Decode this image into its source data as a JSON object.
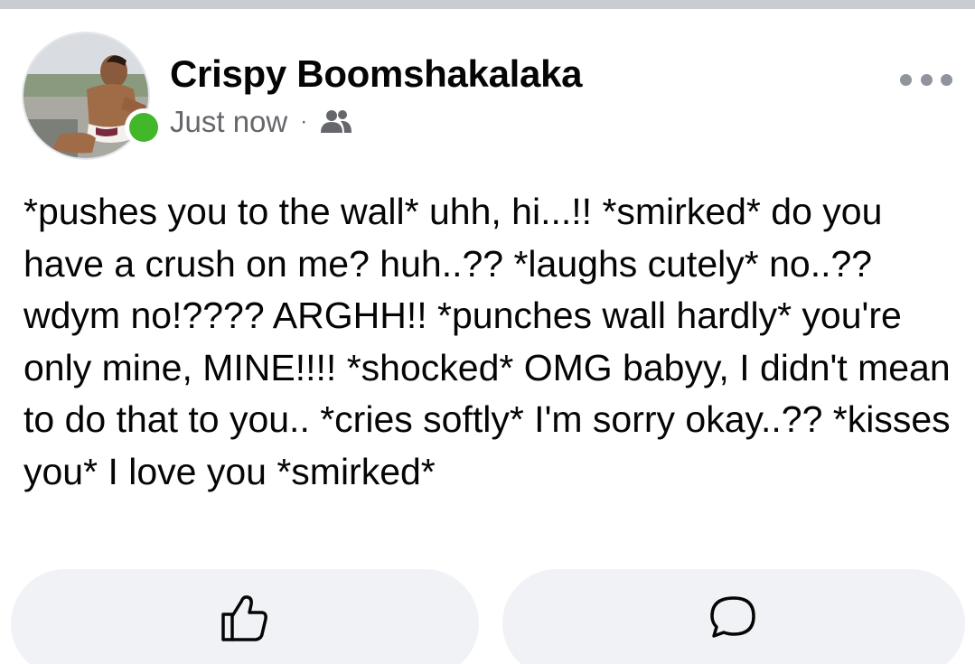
{
  "post": {
    "author": "Crispy Boomshakalaka",
    "timestamp": "Just now",
    "separator": "·",
    "audience_icon": "friends-icon",
    "avatar_status": "online",
    "more_icon": "more-options-icon",
    "text": "*pushes you to the wall* uhh, hi...!! *smirked* do you have a crush on me? huh..?? *laughs cutely* no..?? wdym no!???? ARGHH!! *punches wall hardly* you're only mine, MINE!!!! *shocked* OMG babyy, I didn't mean to do that to you.. *cries softly* I'm sorry okay..?? *kisses you* I love you *smirked*"
  },
  "actions": [
    {
      "name": "like",
      "icon": "thumbs-up-icon"
    },
    {
      "name": "comment",
      "icon": "comment-bubble-icon"
    }
  ],
  "colors": {
    "online_status": "#42b72a",
    "meta_text": "#65676b",
    "button_background": "#f0f2f5",
    "top_bar": "#c9ccd1"
  }
}
